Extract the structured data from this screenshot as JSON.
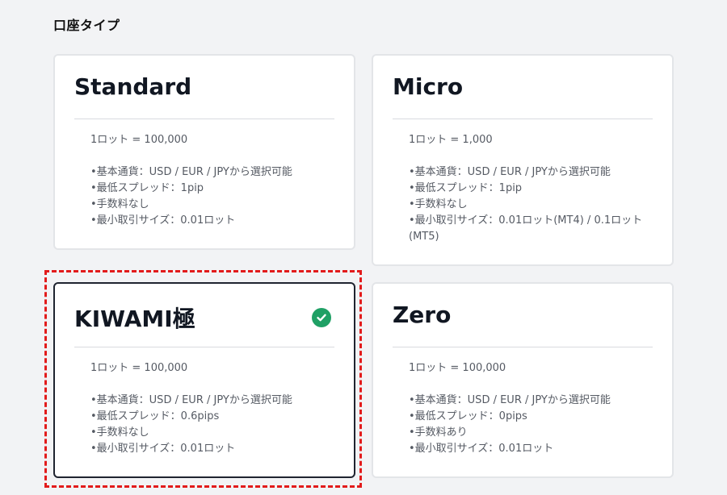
{
  "section": {
    "title": "口座タイプ"
  },
  "cards": [
    {
      "name": "Standard",
      "lot": "1ロット = 100,000",
      "features": [
        "基本通貨：USD / EUR / JPYから選択可能",
        "最低スプレッド：1pip",
        "手数料なし",
        "最小取引サイズ：0.01ロット"
      ]
    },
    {
      "name": "Micro",
      "lot": "1ロット = 1,000",
      "features": [
        "基本通貨：USD / EUR / JPYから選択可能",
        "最低スプレッド：1pip",
        "手数料なし",
        "最小取引サイズ：0.01ロット(MT4) / 0.1ロット(MT5)"
      ]
    },
    {
      "name": "KIWAMI極",
      "lot": "1ロット = 100,000",
      "selected": true,
      "features": [
        "基本通貨：USD / EUR / JPYから選択可能",
        "最低スプレッド：0.6pips",
        "手数料なし",
        "最小取引サイズ：0.01ロット"
      ]
    },
    {
      "name": "Zero",
      "lot": "1ロット = 100,000",
      "features": [
        "基本通貨：USD / EUR / JPYから選択可能",
        "最低スプレッド：0pips",
        "手数料あり",
        "最小取引サイズ：0.01ロット"
      ]
    }
  ],
  "colors": {
    "selected_check": "#1fa065",
    "highlight_border": "#e21b1b",
    "selected_border": "#1f2430"
  },
  "icons": {
    "selected": "check-circle-icon"
  }
}
